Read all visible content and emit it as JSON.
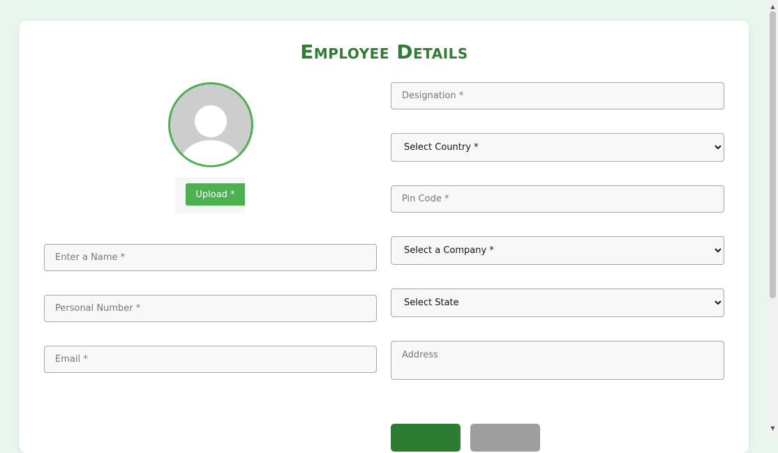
{
  "form": {
    "title": "Employee Details",
    "upload_label": "Upload *",
    "name_placeholder": "Enter a Name *",
    "phone_placeholder": "Personal Number *",
    "email_placeholder": "Email *",
    "designation_placeholder": "Designation *",
    "country_selected": "Select Country *",
    "pincode_placeholder": "Pin Code *",
    "company_selected": "Select a Company *",
    "state_selected": "Select State",
    "address_placeholder": "Address",
    "submit_label": "",
    "reset_label": ""
  },
  "colors": {
    "accent": "#2e7d32",
    "upload": "#4caf50",
    "background": "#e8f5ec"
  },
  "icons": {
    "avatar": "user-silhouette-icon",
    "scroll_up": "chevron-up-icon",
    "scroll_down": "chevron-down-icon"
  }
}
